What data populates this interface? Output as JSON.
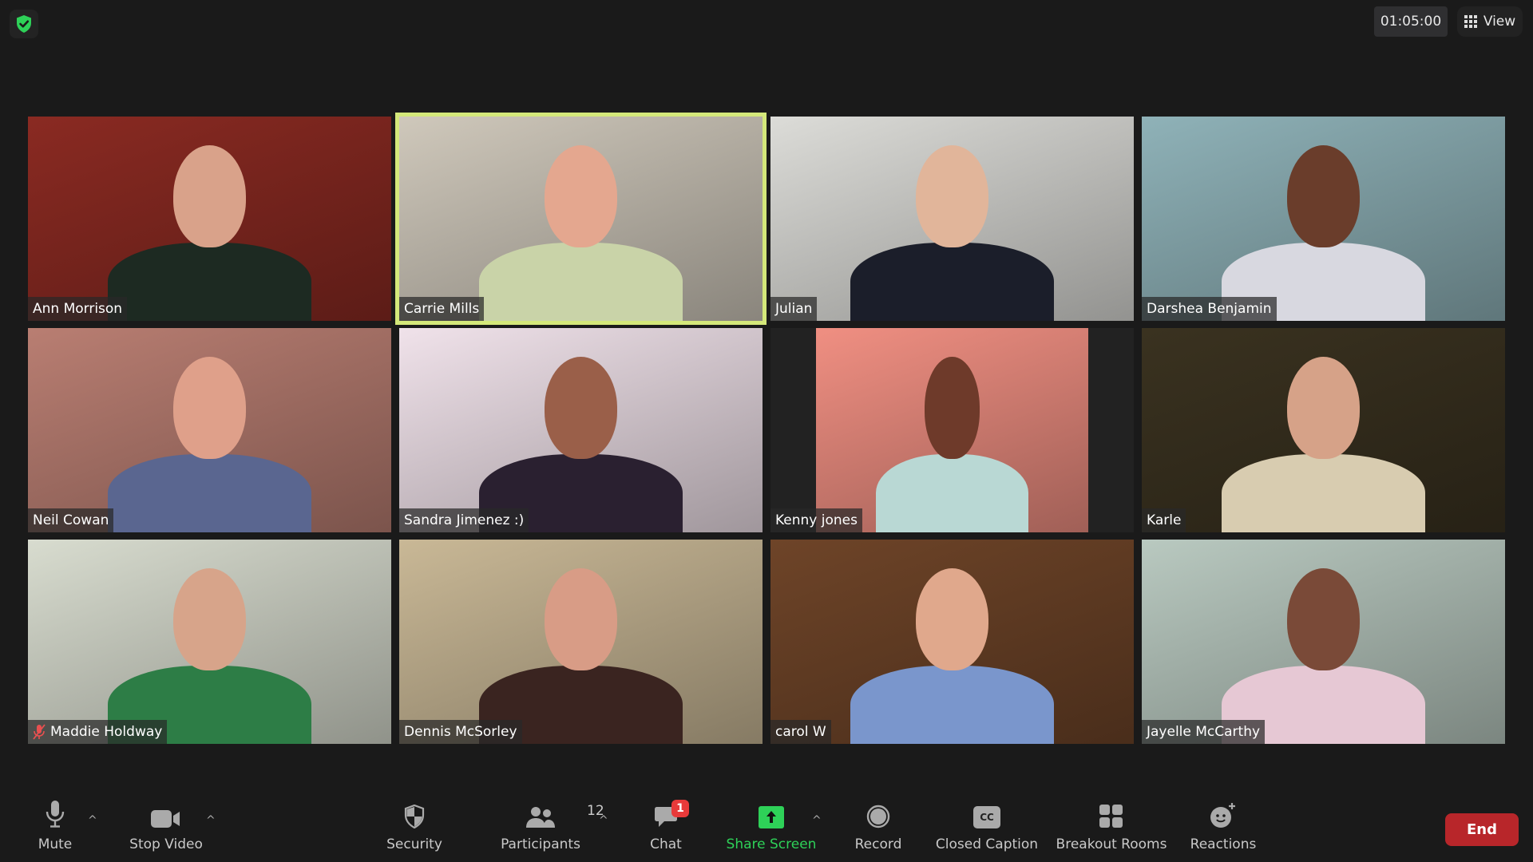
{
  "header": {
    "security_status_icon": "shield-check-icon",
    "security_color": "#2ed158",
    "timer": "01:05:00",
    "view_label": "View",
    "view_icon": "grid-icon"
  },
  "participants": [
    {
      "name": "Ann Morrison",
      "muted": false,
      "active_speaker": false,
      "bg": "#8a2a22",
      "skin": "#d9a28a",
      "shirt": "#1d2a22"
    },
    {
      "name": "Carrie Mills",
      "muted": false,
      "active_speaker": true,
      "bg": "#cfc8bb",
      "skin": "#e4a78f",
      "shirt": "#c9d3a8"
    },
    {
      "name": "Julian",
      "muted": false,
      "active_speaker": false,
      "bg": "#dcdcd8",
      "skin": "#e1b59a",
      "shirt": "#1b1e2a"
    },
    {
      "name": "Darshea Benjamin",
      "muted": false,
      "active_speaker": false,
      "bg": "#8fb2b8",
      "skin": "#6a3d2b",
      "shirt": "#d8d8e0"
    },
    {
      "name": "Neil Cowan",
      "muted": false,
      "active_speaker": false,
      "bg": "#b97e72",
      "skin": "#dfa08a",
      "shirt": "#5a6690"
    },
    {
      "name": "Sandra Jimenez :)",
      "muted": false,
      "active_speaker": false,
      "bg": "#f0e2ea",
      "skin": "#9a5f49",
      "shirt": "#2a2030"
    },
    {
      "name": "Kenny jones",
      "muted": false,
      "active_speaker": false,
      "bg": "#f08f82",
      "skin": "#6e3a2a",
      "shirt": "#b9d8d4"
    },
    {
      "name": "Karle",
      "muted": false,
      "active_speaker": false,
      "bg": "#3a3220",
      "skin": "#d6a288",
      "shirt": "#d8ccb0"
    },
    {
      "name": "Maddie Holdway",
      "muted": true,
      "active_speaker": false,
      "bg": "#d8dccf",
      "skin": "#d7a48a",
      "shirt": "#2d7d46"
    },
    {
      "name": "Dennis McSorley",
      "muted": false,
      "active_speaker": false,
      "bg": "#c9b896",
      "skin": "#d89c86",
      "shirt": "#3a2420"
    },
    {
      "name": "carol W",
      "muted": false,
      "active_speaker": false,
      "bg": "#6e4428",
      "skin": "#e0a88c",
      "shirt": "#7a96cc"
    },
    {
      "name": "Jayelle McCarthy",
      "muted": false,
      "active_speaker": false,
      "bg": "#b9c9c0",
      "skin": "#7a4a38",
      "shirt": "#e6c8d4"
    }
  ],
  "toolbar": {
    "mute": {
      "label": "Mute",
      "icon": "microphone-icon"
    },
    "stop_video": {
      "label": "Stop Video",
      "icon": "video-camera-icon"
    },
    "security": {
      "label": "Security",
      "icon": "shield-icon"
    },
    "participants": {
      "label": "Participants",
      "icon": "people-icon",
      "count": "12"
    },
    "chat": {
      "label": "Chat",
      "icon": "chat-bubble-icon",
      "badge": "1"
    },
    "share_screen": {
      "label": "Share Screen",
      "icon": "share-arrow-icon",
      "color": "#2ed158"
    },
    "record": {
      "label": "Record",
      "icon": "record-icon"
    },
    "closed_caption": {
      "label": "Closed Caption",
      "icon": "cc-icon",
      "glyph": "CC"
    },
    "breakout_rooms": {
      "label": "Breakout Rooms",
      "icon": "breakout-grid-icon"
    },
    "reactions": {
      "label": "Reactions",
      "icon": "smiley-plus-icon"
    },
    "end": {
      "label": "End",
      "color": "#b8262a"
    }
  }
}
